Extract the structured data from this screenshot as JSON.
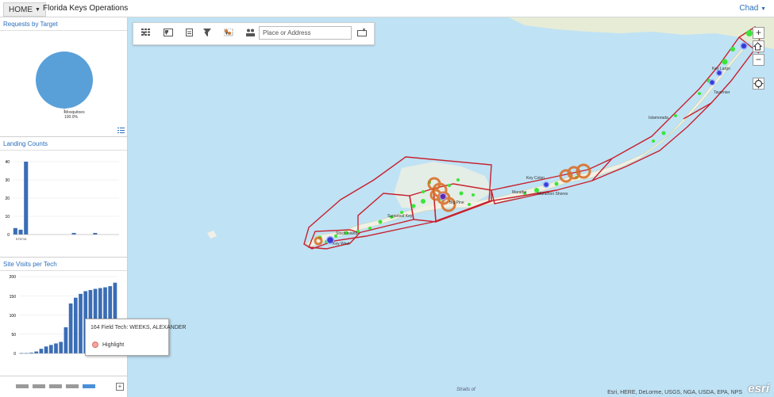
{
  "header": {
    "home_label": "HOME",
    "app_title": "Florida Keys Operations",
    "user": "Chad"
  },
  "panels": {
    "requests": {
      "title": "Requests by Target",
      "slice_label": "Mosquitoes",
      "slice_pct": "100.0%",
      "color": "#5aa0d8"
    },
    "landing": {
      "title": "Landing Counts",
      "y_ticks": [
        "40",
        "30",
        "20",
        "10",
        "0"
      ],
      "x_note": "575715"
    },
    "visits": {
      "title": "Site Visits per Tech",
      "y_ticks": [
        "200",
        "150",
        "100",
        "50",
        "0"
      ]
    }
  },
  "chart_data": [
    {
      "type": "pie",
      "title": "Requests by Target",
      "categories": [
        "Mosquitoes"
      ],
      "values": [
        100.0
      ]
    },
    {
      "type": "bar",
      "title": "Landing Counts",
      "ylim": [
        0,
        45
      ],
      "values": [
        4,
        3,
        45,
        0,
        0,
        0,
        0,
        0,
        0,
        0,
        0,
        1,
        0,
        0,
        0,
        1,
        0,
        0,
        0,
        0
      ]
    },
    {
      "type": "bar",
      "title": "Site Visits per Tech",
      "ylim": [
        0,
        200
      ],
      "values": [
        1,
        1,
        2,
        5,
        12,
        18,
        22,
        26,
        30,
        68,
        130,
        145,
        155,
        162,
        165,
        168,
        170,
        172,
        175,
        184
      ]
    }
  ],
  "tooltip": {
    "title": "164 Field Tech: WEEKS, ALEXANDER",
    "action": "Highlight"
  },
  "map": {
    "search_placeholder": "Place or Address",
    "attribution": "Esri, HERE, DeLorme, USGS, NGA, USDA, EPA, NPS",
    "logo": "esri",
    "water_label": "Straits of",
    "places": {
      "islamorada": "Islamorada",
      "key_colony": "Key Colon",
      "marathon": "Maratho",
      "marathon_shores": "Marathon Shores",
      "big_pine": "Big Pine",
      "sugarloaf": "Sugarloaf Key",
      "stock_island": "Stock Island",
      "key_west": "Key West",
      "tavernier": "Tavernier",
      "key_largo": "Key Largo"
    }
  }
}
